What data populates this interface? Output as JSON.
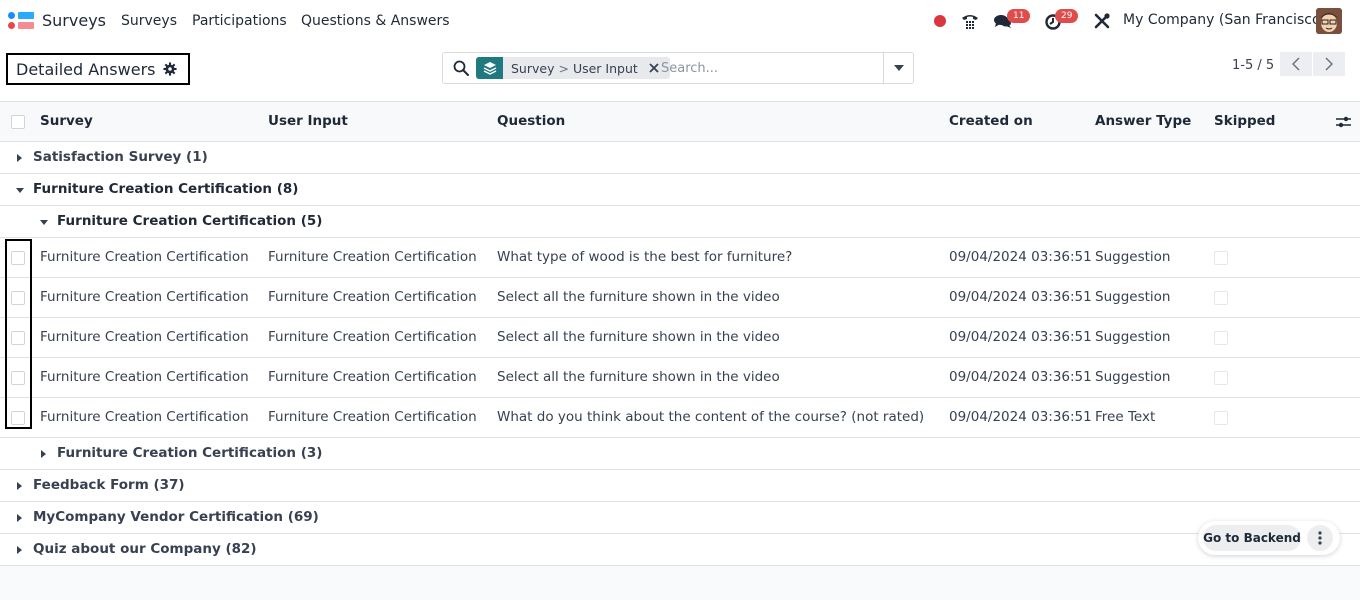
{
  "navbar": {
    "app_name": "Surveys",
    "menu": [
      "Surveys",
      "Participations",
      "Questions & Answers"
    ],
    "icons": [
      "record-dot",
      "phone-icon",
      "chat-icon",
      "activity-clock-icon",
      "debug-tools-icon"
    ],
    "messages_badge": "11",
    "activities_badge": "29",
    "company": "My Company (San Francisco)"
  },
  "control_panel": {
    "title": "Detailed Answers",
    "search": {
      "facet_left": "Survey",
      "facet_sep": ">",
      "facet_right": "User Input",
      "placeholder": "Search..."
    },
    "pager": "1-5 / 5"
  },
  "table": {
    "columns": [
      "Survey",
      "User Input",
      "Question",
      "Created on",
      "Answer Type",
      "Skipped"
    ],
    "groups_top": [
      {
        "label": "Satisfaction Survey (1)",
        "expanded": false
      },
      {
        "label": "Furniture Creation Certification (8)",
        "expanded": true
      }
    ],
    "subgroup_open": {
      "label": "Furniture Creation Certification (5)",
      "expanded": true
    },
    "rows": [
      {
        "survey": "Furniture Creation Certification",
        "user_input": "Furniture Creation Certification",
        "question": "What type of wood is the best for furniture?",
        "created_on": "09/04/2024 03:36:51",
        "answer_type": "Suggestion",
        "skipped": false
      },
      {
        "survey": "Furniture Creation Certification",
        "user_input": "Furniture Creation Certification",
        "question": "Select all the furniture shown in the video",
        "created_on": "09/04/2024 03:36:51",
        "answer_type": "Suggestion",
        "skipped": false
      },
      {
        "survey": "Furniture Creation Certification",
        "user_input": "Furniture Creation Certification",
        "question": "Select all the furniture shown in the video",
        "created_on": "09/04/2024 03:36:51",
        "answer_type": "Suggestion",
        "skipped": false
      },
      {
        "survey": "Furniture Creation Certification",
        "user_input": "Furniture Creation Certification",
        "question": "Select all the furniture shown in the video",
        "created_on": "09/04/2024 03:36:51",
        "answer_type": "Suggestion",
        "skipped": false
      },
      {
        "survey": "Furniture Creation Certification",
        "user_input": "Furniture Creation Certification",
        "question": "What do you think about the content of the course? (not rated)",
        "created_on": "09/04/2024 03:36:51",
        "answer_type": "Free Text",
        "skipped": false
      }
    ],
    "subgroup_closed": {
      "label": "Furniture Creation Certification (3)",
      "expanded": false
    },
    "groups_bottom": [
      {
        "label": "Feedback Form (37)",
        "expanded": false
      },
      {
        "label": "MyCompany Vendor Certification (69)",
        "expanded": false
      },
      {
        "label": "Quiz about our Company (82)",
        "expanded": false
      }
    ]
  },
  "floating": {
    "backend_label": "Go to Backend"
  }
}
